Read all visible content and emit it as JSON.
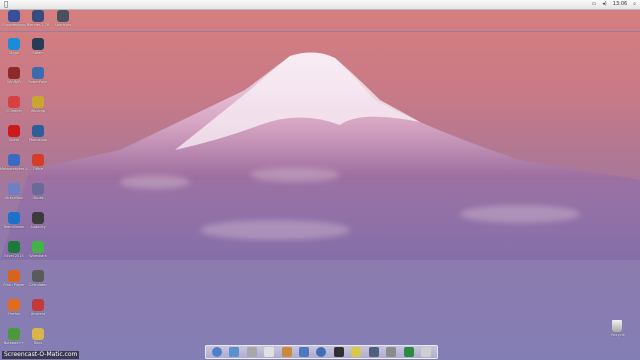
{
  "menubar": {
    "clock": "13:06"
  },
  "top_icons": [
    {
      "label": "Showdesktop",
      "color": "#3a4f9a"
    },
    {
      "label": "Blender 2.76",
      "color": "#3b4b7e"
    },
    {
      "label": "Shortcuts",
      "color": "#4b5060"
    }
  ],
  "left_col": [
    {
      "label": "Skype",
      "color": "#1a8cd8"
    },
    {
      "label": "WinRAR",
      "color": "#8b2a2a"
    },
    {
      "label": "CCleaner",
      "color": "#d64141"
    },
    {
      "label": "Opera",
      "color": "#cc1a1a"
    },
    {
      "label": "Malwarebytes Anti-Malware",
      "color": "#3b6bc1"
    },
    {
      "label": "VirtualBox",
      "color": "#6e7fc6"
    },
    {
      "label": "TeamViewer",
      "color": "#1b72c8"
    },
    {
      "label": "Excel 2013",
      "color": "#1f7a3a"
    },
    {
      "label": "Flash Player",
      "color": "#d8631d"
    },
    {
      "label": "Firefox",
      "color": "#e36b1e"
    },
    {
      "label": "Notepad++",
      "color": "#4a9a3a"
    }
  ],
  "right_col": [
    {
      "label": "Steam",
      "color": "#2a3b55"
    },
    {
      "label": "PowerPoint",
      "color": "#3d6bb0"
    },
    {
      "label": "Winamp",
      "color": "#c9a632"
    },
    {
      "label": "Photoshop",
      "color": "#2a5f9c"
    },
    {
      "label": "Office",
      "color": "#d63c2a"
    },
    {
      "label": "iTunes",
      "color": "#6a6a9a"
    },
    {
      "label": "Audacity",
      "color": "#3b3b3b"
    },
    {
      "label": "Wireshark",
      "color": "#44b34a"
    },
    {
      "label": "Calculator",
      "color": "#5a5a5a"
    },
    {
      "label": "Utorrent",
      "color": "#c33a3a"
    },
    {
      "label": "Paint",
      "color": "#4a6fa0"
    },
    {
      "label": "Docs",
      "color": "#d9b44a"
    }
  ],
  "dock_items": [
    {
      "name": "finder",
      "color": "#4f7fc7"
    },
    {
      "name": "maps",
      "color": "#5a8fd0"
    },
    {
      "name": "files",
      "color": "#a7a7a7"
    },
    {
      "name": "notes",
      "color": "#e0e0e0"
    },
    {
      "name": "mail",
      "color": "#c98a3a"
    },
    {
      "name": "safari",
      "color": "#4d79c0"
    },
    {
      "name": "music",
      "color": "#3f6fb2"
    },
    {
      "name": "video",
      "color": "#303030"
    },
    {
      "name": "home",
      "color": "#d8c84a"
    },
    {
      "name": "monitor",
      "color": "#4f5f7f"
    },
    {
      "name": "settings",
      "color": "#8a8a8a"
    },
    {
      "name": "games",
      "color": "#2e8a3e"
    },
    {
      "name": "trash-dock",
      "color": "#cfcfcf"
    }
  ],
  "trash": {
    "label": "Recycle"
  },
  "watermark": "Screencast-O-Matic.com"
}
